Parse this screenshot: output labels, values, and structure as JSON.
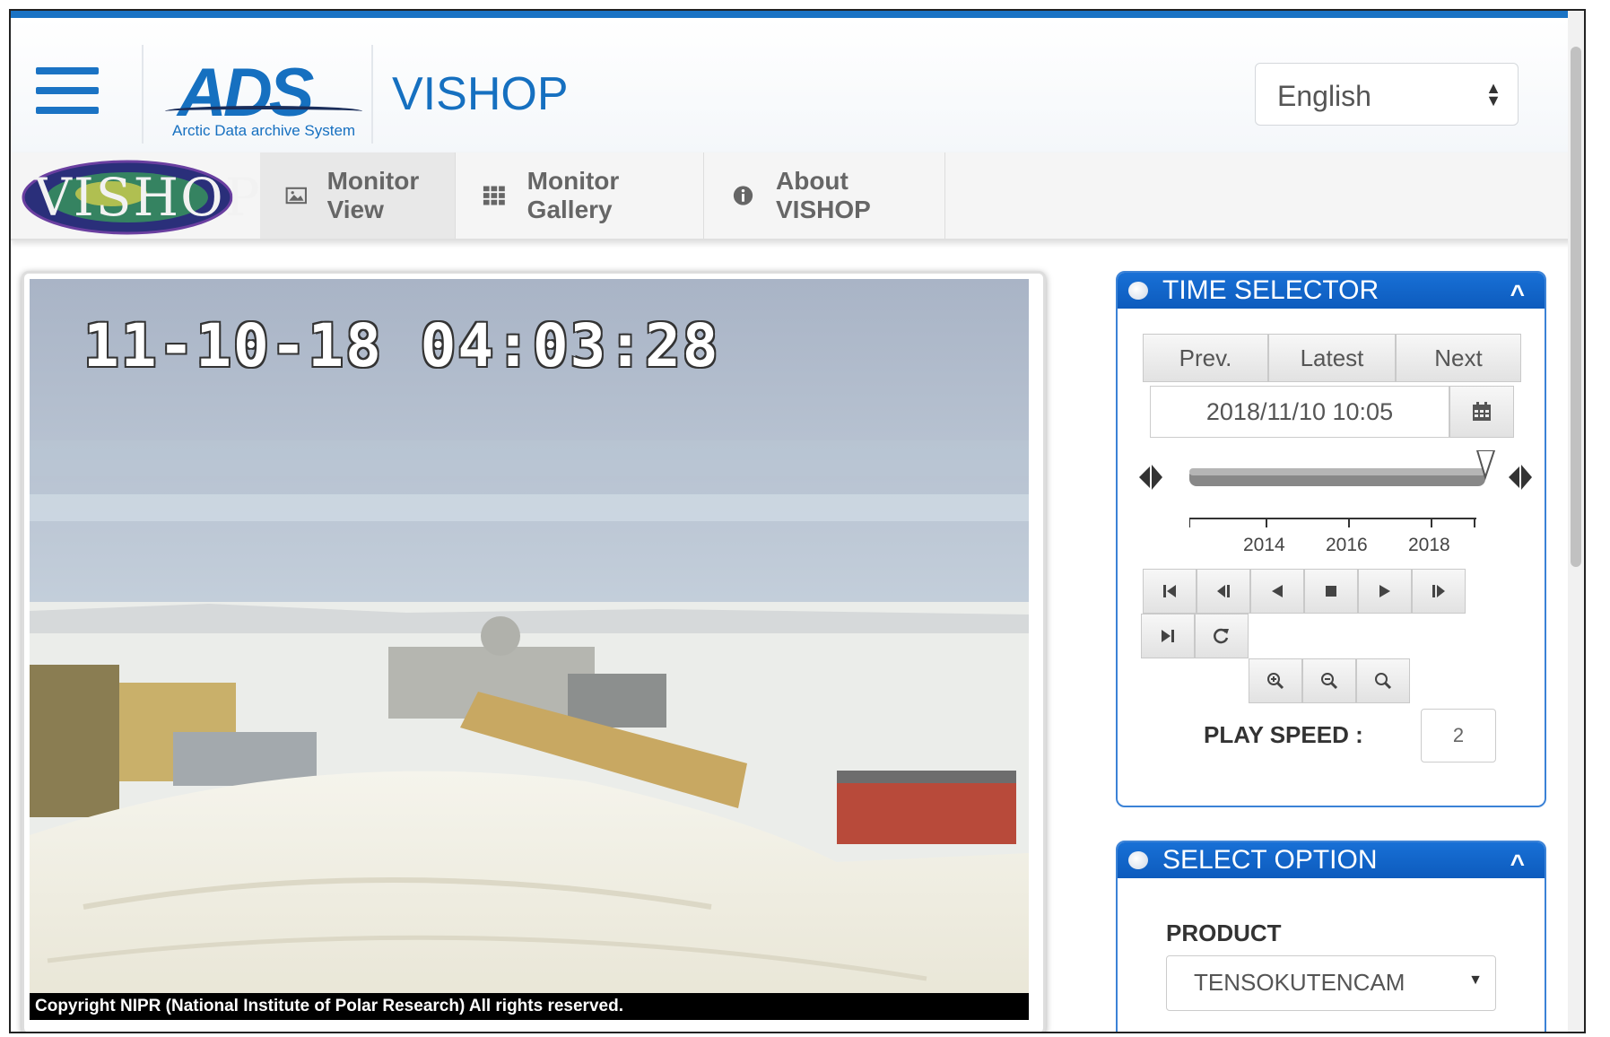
{
  "header": {
    "logo_text": "ADS",
    "logo_subtitle": "Arctic Data archive System",
    "app_title": "VISHOP",
    "language": {
      "selected": "English"
    },
    "colors": {
      "brand": "#1670c0",
      "accent": "#1a73c4"
    }
  },
  "navbar": {
    "badge_text": "VISHOP",
    "items": [
      {
        "label": "Monitor View",
        "icon": "image-icon",
        "active": true
      },
      {
        "label": "Monitor Gallery",
        "icon": "grid-icon",
        "active": false
      },
      {
        "label": "About VISHOP",
        "icon": "info-icon",
        "active": false
      }
    ]
  },
  "monitor": {
    "timestamp": "11-10-18 04:03:28",
    "copyright": "Copyright NIPR (National Institute of Polar Research) All rights reserved."
  },
  "time_selector": {
    "title": "TIME SELECTOR",
    "prev_label": "Prev.",
    "latest_label": "Latest",
    "next_label": "Next",
    "date_value": "2018/11/10 10:05",
    "timeline_ticks": [
      "2014",
      "2016",
      "2018"
    ],
    "play_speed_label": "PLAY SPEED :",
    "play_speed_value": "2"
  },
  "select_option": {
    "title": "SELECT OPTION",
    "product_label": "PRODUCT",
    "product_value": "TENSOKUTENCAM"
  }
}
